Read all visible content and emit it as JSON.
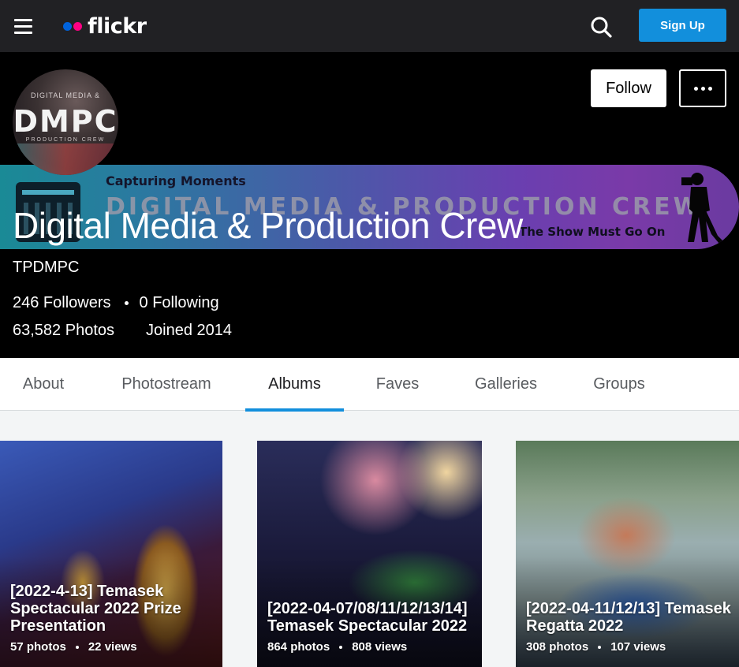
{
  "nav": {
    "logo_text": "flickr",
    "signup_label": "Sign Up",
    "accent_color": "#128fdc"
  },
  "profile": {
    "avatar_top": "DIGITAL MEDIA &",
    "avatar_main": "DMPC",
    "avatar_sub": "PRODUCTION CREW",
    "banner_tagline": "Capturing Moments",
    "banner_name": "DIGITAL MEDIA & PRODUCTION CREW",
    "banner_motto": "The Show Must Go On",
    "name": "Digital Media & Production Crew",
    "username": "TPDMPC",
    "followers": "246 Followers",
    "following": "0 Following",
    "photos": "63,582 Photos",
    "joined": "Joined 2014",
    "follow_label": "Follow"
  },
  "tabs": [
    {
      "label": "About"
    },
    {
      "label": "Photostream"
    },
    {
      "label": "Albums"
    },
    {
      "label": "Faves"
    },
    {
      "label": "Galleries"
    },
    {
      "label": "Groups"
    }
  ],
  "active_tab": "Albums",
  "albums": [
    {
      "title": "[2022-4-13] Temasek Spectacular 2022 Prize Presentation",
      "photos": "57 photos",
      "views": "22 views"
    },
    {
      "title": "[2022-04-07/08/11/12/13/14] Temasek Spectacular 2022",
      "photos": "864 photos",
      "views": "808 views"
    },
    {
      "title": "[2022-04-11/12/13] Temasek Regatta 2022",
      "photos": "308 photos",
      "views": "107 views"
    }
  ]
}
